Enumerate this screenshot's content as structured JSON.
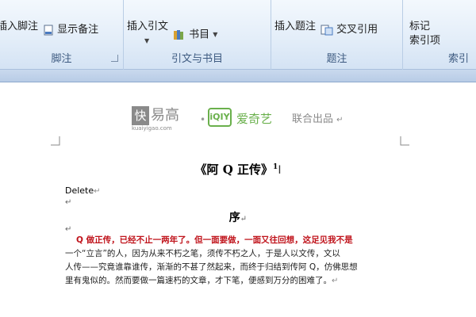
{
  "ribbon": {
    "groups": [
      {
        "label": "脚注",
        "items": [
          "插入脚注",
          "显示备注"
        ]
      },
      {
        "label": "引文与书目",
        "items": [
          "插入引文",
          "书目"
        ]
      },
      {
        "label": "题注",
        "items": [
          "插入题注",
          "交叉引用"
        ]
      },
      {
        "label": "索引",
        "items": [
          "标记",
          "索引项"
        ]
      }
    ]
  },
  "document": {
    "logos": {
      "kuai_char": "快",
      "kuai_name": "易高",
      "kuai_url": "kuaiyigao.com",
      "iqiyi_box": "iQIY",
      "iqiyi_name": "爱奇艺",
      "joint": "联合出品"
    },
    "title": "《阿 Q 正传》",
    "title_sup": "1",
    "delete_text": "Delete",
    "section_title": "序",
    "paragraph_red": "Q 做正传，已经不止一两年了。但一面要做，一面又往回想，这足见我不是",
    "paragraph_lines": [
      "一个“立言”的人，因为从来不朽之笔，须传不朽之人，于是人以文传，文以",
      "人传——究竟谁靠谁传，渐渐的不甚了然起来，而终于归结到传阿 Q，仿佛思想",
      "里有鬼似的。然而要做一篇速朽的文章，才下笔，便感到万分的困难了。"
    ],
    "para_mark": "↵"
  },
  "colors": {
    "ribbon_label": "#3d5a80",
    "red_text": "#c0141c",
    "iqiyi_green": "#6ab04c",
    "logo_gray": "#8a8a8a"
  }
}
